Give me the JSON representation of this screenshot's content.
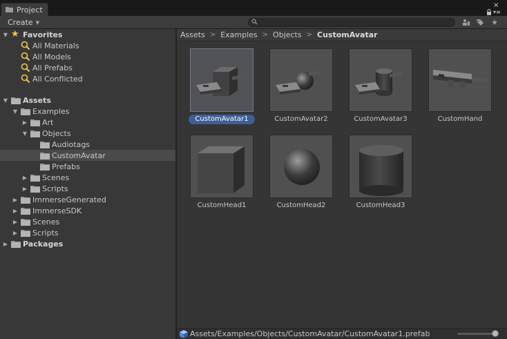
{
  "window": {
    "tab_title": "Project"
  },
  "toolbar": {
    "create_label": "Create",
    "search_value": ""
  },
  "tree": {
    "favorites": {
      "label": "Favorites",
      "items": [
        "All Materials",
        "All Models",
        "All Prefabs",
        "All Conflicted"
      ]
    },
    "assets_label": "Assets",
    "examples_label": "Examples",
    "art_label": "Art",
    "objects_label": "Objects",
    "audiotags_label": "Audiotags",
    "customavatar_label": "CustomAvatar",
    "prefabs_label": "Prefabs",
    "scenes_label": "Scenes",
    "scripts_label": "Scripts",
    "immersegenerated_label": "ImmerseGenerated",
    "immersesdk_label": "ImmerseSDK",
    "scenes2_label": "Scenes",
    "scripts2_label": "Scripts",
    "packages_label": "Packages"
  },
  "breadcrumb": [
    "Assets",
    "Examples",
    "Objects",
    "CustomAvatar"
  ],
  "assets": [
    {
      "name": "CustomAvatar1",
      "selected": true,
      "shape": "avatar-cube"
    },
    {
      "name": "CustomAvatar2",
      "selected": false,
      "shape": "avatar-sphere"
    },
    {
      "name": "CustomAvatar3",
      "selected": false,
      "shape": "avatar-cylinder"
    },
    {
      "name": "CustomHand",
      "selected": false,
      "shape": "hand"
    },
    {
      "name": "CustomHead1",
      "selected": false,
      "shape": "cube"
    },
    {
      "name": "CustomHead2",
      "selected": false,
      "shape": "sphere"
    },
    {
      "name": "CustomHead3",
      "selected": false,
      "shape": "cylinder"
    }
  ],
  "status": {
    "path": "Assets/Examples/Objects/CustomAvatar/CustomAvatar1.prefab"
  },
  "colors": {
    "selection": "#3e5f96",
    "star": "#f2c94c",
    "search_icon": "#f2c94c"
  }
}
